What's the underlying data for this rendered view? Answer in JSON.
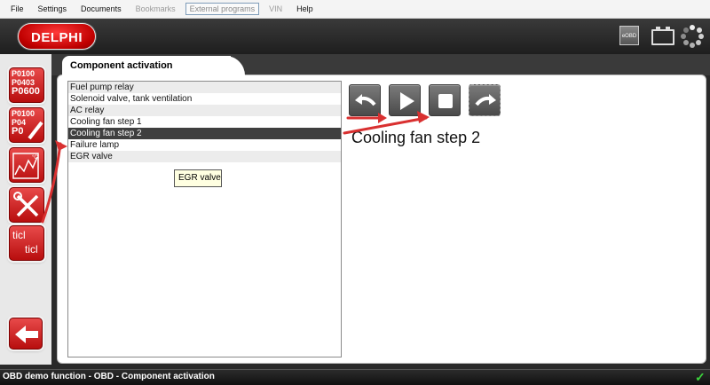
{
  "menu": [
    "File",
    "Settings",
    "Documents",
    "Bookmarks",
    "External programs",
    "VIN",
    "Help"
  ],
  "header": {
    "logo_text": "DELPHI",
    "eobd_label": "eOBD"
  },
  "sidebar": {
    "dtc_codes": [
      "P0100",
      "P0403",
      "P0600"
    ],
    "clear_codes": [
      "P0100",
      "P04",
      "P0"
    ],
    "ticl_top": "ticl",
    "ticl_bottom": "ticl"
  },
  "tab": {
    "title": "Component activation"
  },
  "components": [
    "Fuel pump relay",
    "Solenoid valve, tank ventilation",
    "AC relay",
    "Cooling fan step 1",
    "Cooling fan step 2",
    "Failure lamp",
    "EGR valve"
  ],
  "selected_index": 4,
  "tooltip": "EGR valve",
  "selected_component": "Cooling fan step 2",
  "status": "OBD demo function - OBD - Component activation",
  "colors": {
    "accent_red": "#c00000",
    "selection": "#3f3f3f",
    "annotation": "#d93030"
  }
}
